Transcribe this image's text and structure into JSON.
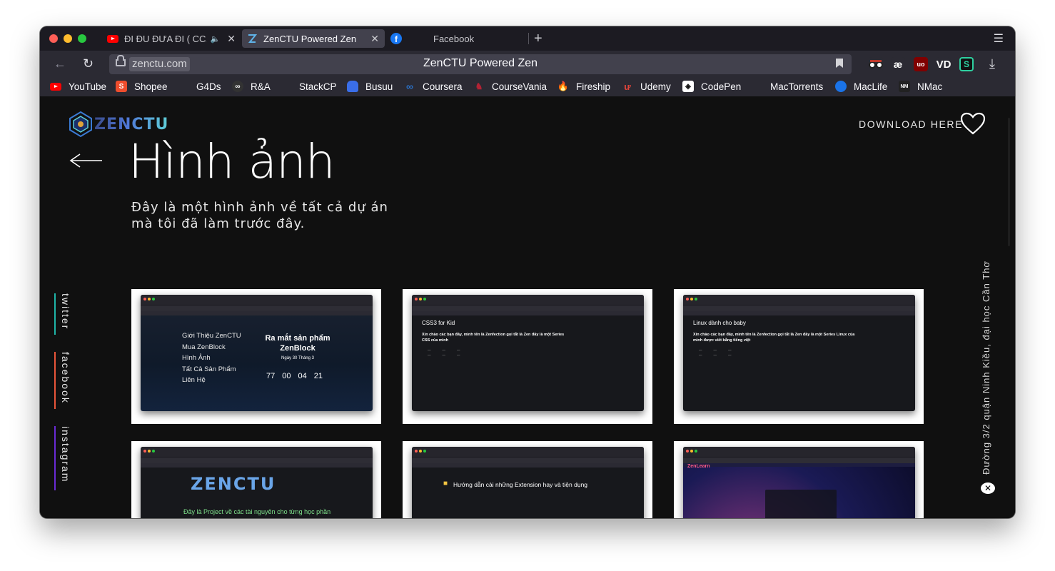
{
  "browser": {
    "tabs": [
      {
        "title": "ĐI ĐU ĐƯA ĐI ( CCA",
        "icon": "youtube-icon",
        "audio": true
      },
      {
        "title": "ZenCTU Powered Zen",
        "icon": "zenctu-icon",
        "active": true
      },
      {
        "title": "Facebook",
        "icon": "facebook-icon"
      }
    ],
    "url": "zenctu.com",
    "page_title": "ZenCTU Powered Zen",
    "bookmarks": [
      {
        "label": "YouTube",
        "icon": "youtube-icon",
        "color": "#ff0000"
      },
      {
        "label": "Shopee",
        "icon": "shopee-icon",
        "color": "#ee4d2d"
      },
      {
        "label": "G4Ds",
        "icon": "g4ds-icon",
        "color": "#2b2a33"
      },
      {
        "label": "R&A",
        "icon": "ra-icon",
        "color": "#333333"
      },
      {
        "label": "StackCP",
        "icon": "stackcp-icon",
        "color": "#2b2a33"
      },
      {
        "label": "Busuu",
        "icon": "busuu-icon",
        "color": "#3a6ee8"
      },
      {
        "label": "Coursera",
        "icon": "coursera-icon",
        "color": "#2a73cc"
      },
      {
        "label": "CourseVania",
        "icon": "coursevania-icon",
        "color": "#b22234"
      },
      {
        "label": "Fireship",
        "icon": "fireship-icon",
        "color": "#ff6a3d"
      },
      {
        "label": "Udemy",
        "icon": "udemy-icon",
        "color": "#a435f0"
      },
      {
        "label": "CodePen",
        "icon": "codepen-icon",
        "color": "#ffffff"
      },
      {
        "label": "MacTorrents",
        "icon": "mactorrents-icon",
        "color": "#2b2a33"
      },
      {
        "label": "MacLife",
        "icon": "maclife-icon",
        "color": "#1a73e8"
      },
      {
        "label": "NMac",
        "icon": "nmac-icon",
        "color": "#222222"
      }
    ],
    "extensions": [
      "spy-glasses-icon",
      "ae-icon",
      "ublock-icon",
      "vd-icon",
      "s-icon"
    ]
  },
  "page": {
    "logo_text": "ZENCTU",
    "download_label": "DOWNLOAD HERE",
    "title": "Hình ảnh",
    "subtitle": "Đây là một hình ảnh về tất cả dự án mà tôi đã làm trước đây.",
    "socials": [
      {
        "label": "twitter",
        "color": "#1fb5a8"
      },
      {
        "label": "facebook",
        "color": "#e8553a"
      },
      {
        "label": "instagram",
        "color": "#6a2bd6"
      }
    ],
    "address": "Đường 3/2 quận Ninh Kiều, đại học Cần Thơ",
    "cards": [
      {
        "menu": [
          "Giới Thiệu ZenCTU",
          "Mua ZenBlock",
          "Hình Ảnh",
          "Tất Cả Sản Phẩm",
          "Liên Hệ"
        ],
        "promo_title": "Ra mắt sản phẩm ZenBlock",
        "promo_date": "Ngày 30 Tháng 3",
        "countdown": [
          "77",
          "00",
          "04",
          "21"
        ]
      },
      {
        "heading": "CSS3 for Kid",
        "intro": "Xin chào các bạn đây, mình tên là Zenfection gọi tắt là Zen đây là một Series CSS của mình"
      },
      {
        "heading": "Linux dành cho baby",
        "intro": "Xin chào các bạn đây, mình tên là Zenfection gọi tắt là Zen đây là một Series Linux của mình được viết bằng tiếng việt"
      },
      {
        "logo": "ZENCTU",
        "text": "Đây là Project về các tài nguyên cho từng học phần trong ngành Công nghệ thông tin trong Đại học"
      },
      {
        "heading": "Hướng dẫn cài những Extension hay và tiện dụng"
      },
      {
        "brand": "ZenLearn"
      }
    ]
  }
}
